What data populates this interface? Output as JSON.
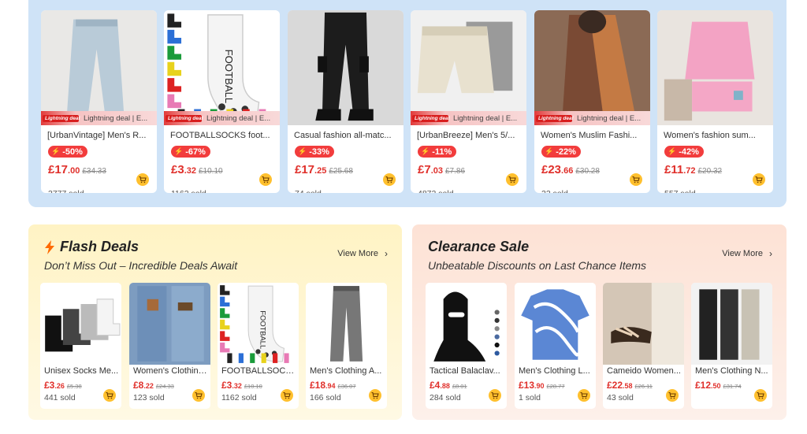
{
  "top_products": [
    {
      "title": "[UrbanVintage] Men's R...",
      "lightning": true,
      "lightning_label": "Lightning deal | E...",
      "tag": "Lightning deal",
      "discount": "-50%",
      "price_main": "£17",
      "price_dec": ".00",
      "old_price": "£34.33",
      "sold": "3777 sold",
      "img": "jeans"
    },
    {
      "title": "FOOTBALLSOCKS foot...",
      "lightning": true,
      "lightning_label": "Lightning deal | E...",
      "tag": "Lightning deal",
      "discount": "-67%",
      "price_main": "£3",
      "price_dec": ".32",
      "old_price": "£10.10",
      "sold": "1162 sold",
      "img": "socks"
    },
    {
      "title": "Casual fashion all-matc...",
      "lightning": false,
      "discount": "-33%",
      "price_main": "£17",
      "price_dec": ".25",
      "old_price": "£25.68",
      "sold": "74 sold",
      "img": "cargo"
    },
    {
      "title": "[UrbanBreeze] Men's 5/...",
      "lightning": true,
      "lightning_label": "Lightning deal | E...",
      "tag": "Lightning deal",
      "discount": "-11%",
      "price_main": "£7",
      "price_dec": ".03",
      "old_price": "£7.86",
      "sold": "4872 sold",
      "img": "shorts"
    },
    {
      "title": "Women's Muslim Fashi...",
      "lightning": true,
      "lightning_label": "Lightning deal | E...",
      "tag": "Lightning deal",
      "discount": "-22%",
      "price_main": "£23",
      "price_dec": ".66",
      "old_price": "£30.28",
      "sold": "22 sold",
      "img": "abaya"
    },
    {
      "title": "Women's fashion sum...",
      "lightning": false,
      "discount": "-42%",
      "price_main": "£11",
      "price_dec": ".72",
      "old_price": "£20.32",
      "sold": "557 sold",
      "img": "pink"
    }
  ],
  "flash": {
    "title": "Flash Deals",
    "subtitle": "Don’t Miss Out – Incredible Deals Await",
    "view_more": "View More",
    "items": [
      {
        "title": "Unisex Socks Me...",
        "price_main": "£3",
        "price_dec": ".26",
        "old_price": "£5.38",
        "sold": "441 sold",
        "img": "ankle"
      },
      {
        "title": "Women's Clothing...",
        "price_main": "£8",
        "price_dec": ".22",
        "old_price": "£24.33",
        "sold": "123 sold",
        "img": "jeans2"
      },
      {
        "title": "FOOTBALLSOCK...",
        "price_main": "£3",
        "price_dec": ".32",
        "old_price": "£10.10",
        "sold": "1162 sold",
        "img": "socks"
      },
      {
        "title": "Men's Clothing A...",
        "price_main": "£18",
        "price_dec": ".94",
        "old_price": "£36.07",
        "sold": "166 sold",
        "img": "greyjeans"
      }
    ]
  },
  "clearance": {
    "title": "Clearance Sale",
    "subtitle": "Unbeatable Discounts on Last Chance Items",
    "view_more": "View More",
    "items": [
      {
        "title": "Tactical Balaclav...",
        "price_main": "£4",
        "price_dec": ".88",
        "old_price": "£8.01",
        "sold": "284 sold",
        "img": "balaclava"
      },
      {
        "title": "Men's Clothing L...",
        "price_main": "£13",
        "price_dec": ".90",
        "old_price": "£28.77",
        "sold": "1 sold",
        "img": "shirt"
      },
      {
        "title": "Cameido Women...",
        "price_main": "£22",
        "price_dec": ".58",
        "old_price": "£26.11",
        "sold": "43 sold",
        "img": "sandal"
      },
      {
        "title": "Men's Clothing N...",
        "price_main": "£12",
        "price_dec": ".50",
        "old_price": "£31.74",
        "sold": "",
        "img": "pants"
      }
    ]
  },
  "colors": {
    "accent": "#e0302b",
    "cart": "#ffc02e",
    "top_band": "#cfe3f7"
  }
}
